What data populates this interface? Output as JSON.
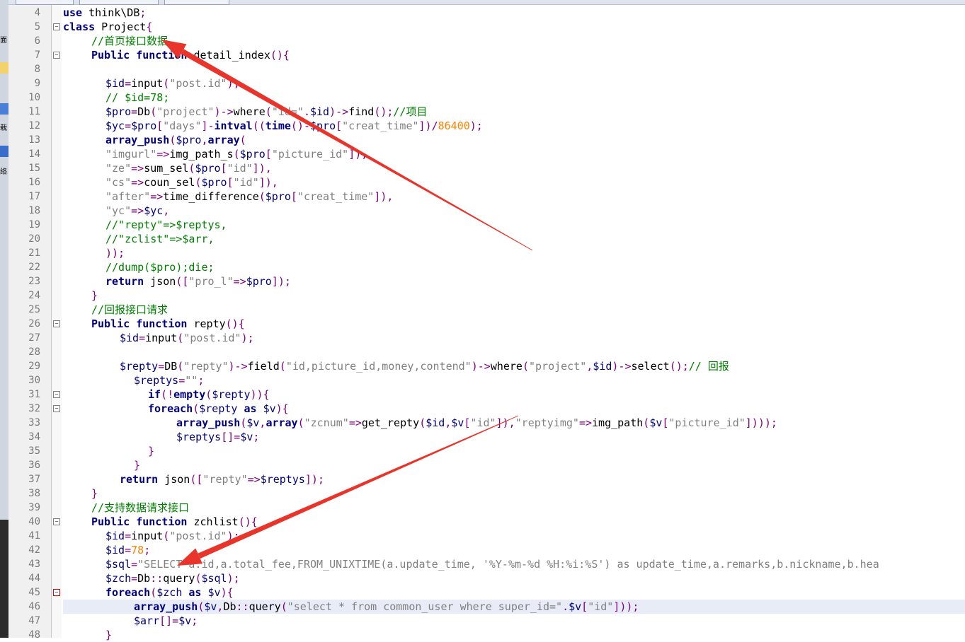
{
  "sidebar": {
    "icons": [
      "面",
      "",
      "",
      "",
      "栽",
      "",
      "络"
    ]
  },
  "editor": {
    "lines": [
      {
        "n": "4",
        "indent": 0,
        "tokens": [
          [
            "kw",
            "use"
          ],
          [
            "fn",
            " think\\DB"
          ],
          [
            "op",
            ";"
          ]
        ]
      },
      {
        "n": "5",
        "indent": 0,
        "tokens": [
          [
            "kw",
            "class"
          ],
          [
            "fn",
            " Project"
          ],
          [
            "op",
            "{"
          ]
        ]
      },
      {
        "n": "6",
        "indent": 2,
        "tokens": [
          [
            "cm",
            "//首页接口数据"
          ]
        ]
      },
      {
        "n": "7",
        "indent": 2,
        "tokens": [
          [
            "kw",
            "Public function"
          ],
          [
            "fn",
            " detail_index"
          ],
          [
            "op",
            "(){"
          ]
        ]
      },
      {
        "n": "8",
        "indent": 0,
        "tokens": []
      },
      {
        "n": "9",
        "indent": 3,
        "tokens": [
          [
            "var",
            "$id"
          ],
          [
            "op",
            "="
          ],
          [
            "fn",
            "input"
          ],
          [
            "op",
            "("
          ],
          [
            "str",
            "\"post.id\""
          ],
          [
            "op",
            ");"
          ]
        ]
      },
      {
        "n": "10",
        "indent": 3,
        "tokens": [
          [
            "cm",
            "// $id=78;"
          ]
        ]
      },
      {
        "n": "11",
        "indent": 3,
        "tokens": [
          [
            "var",
            "$pro"
          ],
          [
            "op",
            "="
          ],
          [
            "fn",
            "Db"
          ],
          [
            "op",
            "("
          ],
          [
            "str",
            "\"project\""
          ],
          [
            "op",
            ")->"
          ],
          [
            "fn",
            "where"
          ],
          [
            "op",
            "("
          ],
          [
            "str",
            "\"id=\""
          ],
          [
            "op",
            "."
          ],
          [
            "var",
            "$id"
          ],
          [
            "op",
            ")->"
          ],
          [
            "fn",
            "find"
          ],
          [
            "op",
            "();"
          ],
          [
            "cm",
            "//项目"
          ]
        ]
      },
      {
        "n": "12",
        "indent": 3,
        "tokens": [
          [
            "var",
            "$yc"
          ],
          [
            "op",
            "="
          ],
          [
            "var",
            "$pro"
          ],
          [
            "op",
            "["
          ],
          [
            "str",
            "\"days\""
          ],
          [
            "op",
            "]-"
          ],
          [
            "kw",
            "intval"
          ],
          [
            "op",
            "(("
          ],
          [
            "kw",
            "time"
          ],
          [
            "op",
            "()-"
          ],
          [
            "var",
            "$pro"
          ],
          [
            "op",
            "["
          ],
          [
            "str",
            "\"creat_time\""
          ],
          [
            "op",
            "])/"
          ],
          [
            "num",
            "86400"
          ],
          [
            "op",
            ");"
          ]
        ]
      },
      {
        "n": "13",
        "indent": 3,
        "tokens": [
          [
            "kw",
            "array_push"
          ],
          [
            "op",
            "("
          ],
          [
            "var",
            "$pro"
          ],
          [
            "op",
            ","
          ],
          [
            "kw",
            "array"
          ],
          [
            "op",
            "("
          ]
        ]
      },
      {
        "n": "14",
        "indent": 3,
        "tokens": [
          [
            "str",
            "\"imgurl\""
          ],
          [
            "op",
            "=>"
          ],
          [
            "fn",
            "img_path_s"
          ],
          [
            "op",
            "("
          ],
          [
            "var",
            "$pro"
          ],
          [
            "op",
            "["
          ],
          [
            "str",
            "\"picture_id\""
          ],
          [
            "op",
            "]),"
          ]
        ]
      },
      {
        "n": "15",
        "indent": 3,
        "tokens": [
          [
            "str",
            "\"ze\""
          ],
          [
            "op",
            "=>"
          ],
          [
            "fn",
            "sum_sel"
          ],
          [
            "op",
            "("
          ],
          [
            "var",
            "$pro"
          ],
          [
            "op",
            "["
          ],
          [
            "str",
            "\"id\""
          ],
          [
            "op",
            "]),"
          ]
        ]
      },
      {
        "n": "16",
        "indent": 3,
        "tokens": [
          [
            "str",
            "\"cs\""
          ],
          [
            "op",
            "=>"
          ],
          [
            "fn",
            "coun_sel"
          ],
          [
            "op",
            "("
          ],
          [
            "var",
            "$pro"
          ],
          [
            "op",
            "["
          ],
          [
            "str",
            "\"id\""
          ],
          [
            "op",
            "]),"
          ]
        ]
      },
      {
        "n": "17",
        "indent": 3,
        "tokens": [
          [
            "str",
            "\"after\""
          ],
          [
            "op",
            "=>"
          ],
          [
            "fn",
            "time_difference"
          ],
          [
            "op",
            "("
          ],
          [
            "var",
            "$pro"
          ],
          [
            "op",
            "["
          ],
          [
            "str",
            "\"creat_time\""
          ],
          [
            "op",
            "]),"
          ]
        ]
      },
      {
        "n": "18",
        "indent": 3,
        "tokens": [
          [
            "str",
            "\"yc\""
          ],
          [
            "op",
            "=>"
          ],
          [
            "var",
            "$yc"
          ],
          [
            "op",
            ","
          ]
        ]
      },
      {
        "n": "19",
        "indent": 3,
        "tokens": [
          [
            "cm",
            "//\"repty\"=>$reptys,"
          ]
        ]
      },
      {
        "n": "20",
        "indent": 3,
        "tokens": [
          [
            "cm",
            "//\"zclist\"=>$arr,"
          ]
        ]
      },
      {
        "n": "21",
        "indent": 3,
        "tokens": [
          [
            "op",
            "));"
          ]
        ]
      },
      {
        "n": "22",
        "indent": 3,
        "tokens": [
          [
            "cm",
            "//dump($pro);die;"
          ]
        ]
      },
      {
        "n": "23",
        "indent": 3,
        "tokens": [
          [
            "kw",
            "return"
          ],
          [
            "fn",
            " json"
          ],
          [
            "op",
            "(["
          ],
          [
            "str",
            "\"pro_l\""
          ],
          [
            "op",
            "=>"
          ],
          [
            "var",
            "$pro"
          ],
          [
            "op",
            "]);"
          ]
        ]
      },
      {
        "n": "24",
        "indent": 2,
        "tokens": [
          [
            "op",
            "}"
          ]
        ]
      },
      {
        "n": "25",
        "indent": 2,
        "tokens": [
          [
            "cm",
            "//回报接口请求"
          ]
        ]
      },
      {
        "n": "26",
        "indent": 2,
        "tokens": [
          [
            "kw",
            "Public function"
          ],
          [
            "fn",
            " repty"
          ],
          [
            "op",
            "(){"
          ]
        ]
      },
      {
        "n": "27",
        "indent": 4,
        "tokens": [
          [
            "var",
            "$id"
          ],
          [
            "op",
            "="
          ],
          [
            "fn",
            "input"
          ],
          [
            "op",
            "("
          ],
          [
            "str",
            "\"post.id\""
          ],
          [
            "op",
            ");"
          ]
        ]
      },
      {
        "n": "28",
        "indent": 0,
        "tokens": []
      },
      {
        "n": "29",
        "indent": 4,
        "tokens": [
          [
            "var",
            "$repty"
          ],
          [
            "op",
            "="
          ],
          [
            "fn",
            "DB"
          ],
          [
            "op",
            "("
          ],
          [
            "str",
            "\"repty\""
          ],
          [
            "op",
            ")->"
          ],
          [
            "fn",
            "field"
          ],
          [
            "op",
            "("
          ],
          [
            "str",
            "\"id,picture_id,money,contend\""
          ],
          [
            "op",
            ")->"
          ],
          [
            "fn",
            "where"
          ],
          [
            "op",
            "("
          ],
          [
            "str",
            "\"project\""
          ],
          [
            "op",
            ","
          ],
          [
            "var",
            "$id"
          ],
          [
            "op",
            ")->"
          ],
          [
            "fn",
            "select"
          ],
          [
            "op",
            "();"
          ],
          [
            "cm",
            "// 回报"
          ]
        ]
      },
      {
        "n": "30",
        "indent": 5,
        "tokens": [
          [
            "var",
            "$reptys"
          ],
          [
            "op",
            "="
          ],
          [
            "str",
            "\"\""
          ],
          [
            "op",
            ";"
          ]
        ]
      },
      {
        "n": "31",
        "indent": 6,
        "tokens": [
          [
            "kw",
            "if"
          ],
          [
            "op",
            "(!"
          ],
          [
            "kw",
            "empty"
          ],
          [
            "op",
            "("
          ],
          [
            "var",
            "$repty"
          ],
          [
            "op",
            "))"
          ],
          [
            "op",
            "{"
          ]
        ]
      },
      {
        "n": "32",
        "indent": 6,
        "tokens": [
          [
            "kw",
            "foreach"
          ],
          [
            "op",
            "("
          ],
          [
            "var",
            "$repty"
          ],
          [
            "kw",
            " as "
          ],
          [
            "var",
            "$v"
          ],
          [
            "op",
            "){"
          ]
        ]
      },
      {
        "n": "33",
        "indent": 8,
        "tokens": [
          [
            "kw",
            "array_push"
          ],
          [
            "op",
            "("
          ],
          [
            "var",
            "$v"
          ],
          [
            "op",
            ","
          ],
          [
            "kw",
            "array"
          ],
          [
            "op",
            "("
          ],
          [
            "str",
            "\"zcnum\""
          ],
          [
            "op",
            "=>"
          ],
          [
            "fn",
            "get_repty"
          ],
          [
            "op",
            "("
          ],
          [
            "var",
            "$id"
          ],
          [
            "op",
            ","
          ],
          [
            "var",
            "$v"
          ],
          [
            "op",
            "["
          ],
          [
            "str",
            "\"id\""
          ],
          [
            "op",
            "]),"
          ],
          [
            "str",
            "\"reptyimg\""
          ],
          [
            "op",
            "=>"
          ],
          [
            "fn",
            "img_path"
          ],
          [
            "op",
            "("
          ],
          [
            "var",
            "$v"
          ],
          [
            "op",
            "["
          ],
          [
            "str",
            "\"picture_id\""
          ],
          [
            "op",
            "])));"
          ]
        ]
      },
      {
        "n": "34",
        "indent": 8,
        "tokens": [
          [
            "var",
            "$reptys"
          ],
          [
            "op",
            "[]="
          ],
          [
            "var",
            "$v"
          ],
          [
            "op",
            ";"
          ]
        ]
      },
      {
        "n": "35",
        "indent": 6,
        "tokens": [
          [
            "op",
            "}"
          ]
        ]
      },
      {
        "n": "36",
        "indent": 5,
        "tokens": [
          [
            "op",
            "}"
          ]
        ]
      },
      {
        "n": "37",
        "indent": 4,
        "tokens": [
          [
            "kw",
            "return"
          ],
          [
            "fn",
            " json"
          ],
          [
            "op",
            "(["
          ],
          [
            "str",
            "\"repty\""
          ],
          [
            "op",
            "=>"
          ],
          [
            "var",
            "$reptys"
          ],
          [
            "op",
            "]);"
          ]
        ]
      },
      {
        "n": "38",
        "indent": 2,
        "tokens": [
          [
            "op",
            "}"
          ]
        ]
      },
      {
        "n": "39",
        "indent": 2,
        "tokens": [
          [
            "cm",
            "//支持数据请求接口"
          ]
        ]
      },
      {
        "n": "40",
        "indent": 2,
        "tokens": [
          [
            "kw",
            "Public function"
          ],
          [
            "fn",
            " zchlist"
          ],
          [
            "op",
            "(){"
          ]
        ]
      },
      {
        "n": "41",
        "indent": 3,
        "tokens": [
          [
            "var",
            "$id"
          ],
          [
            "op",
            "="
          ],
          [
            "fn",
            "input"
          ],
          [
            "op",
            "("
          ],
          [
            "str",
            "\"post.id\""
          ],
          [
            "op",
            ");"
          ]
        ]
      },
      {
        "n": "42",
        "indent": 3,
        "tokens": [
          [
            "var",
            "$id"
          ],
          [
            "op",
            "="
          ],
          [
            "num",
            "78"
          ],
          [
            "op",
            ";"
          ]
        ]
      },
      {
        "n": "43",
        "indent": 3,
        "tokens": [
          [
            "var",
            "$sql"
          ],
          [
            "op",
            "="
          ],
          [
            "str",
            "\"SELECT a.id,a.total_fee,FROM_UNIXTIME(a.update_time, '%Y-%m-%d %H:%i:%S') as update_time,a.remarks,b.nickname,b.hea"
          ]
        ]
      },
      {
        "n": "44",
        "indent": 3,
        "tokens": [
          [
            "var",
            "$zch"
          ],
          [
            "op",
            "="
          ],
          [
            "fn",
            "Db"
          ],
          [
            "op",
            "::"
          ],
          [
            "fn",
            "query"
          ],
          [
            "op",
            "("
          ],
          [
            "var",
            "$sql"
          ],
          [
            "op",
            ");"
          ]
        ]
      },
      {
        "n": "45",
        "indent": 3,
        "tokens": [
          [
            "kw",
            "foreach"
          ],
          [
            "op",
            "("
          ],
          [
            "var",
            "$zch"
          ],
          [
            "kw",
            " as "
          ],
          [
            "var",
            "$v"
          ],
          [
            "op",
            "){"
          ]
        ]
      },
      {
        "n": "46",
        "indent": 5,
        "tokens": [
          [
            "kw",
            "array_push"
          ],
          [
            "op",
            "("
          ],
          [
            "var",
            "$v"
          ],
          [
            "op",
            ","
          ],
          [
            "fn",
            "Db"
          ],
          [
            "op",
            "::"
          ],
          [
            "fn",
            "query"
          ],
          [
            "op",
            "("
          ],
          [
            "str",
            "\"select * from common_user where super_id=\""
          ],
          [
            "op",
            "."
          ],
          [
            "var",
            "$v"
          ],
          [
            "op",
            "["
          ],
          [
            "str",
            "\"id\""
          ],
          [
            "op",
            "]));"
          ]
        ]
      },
      {
        "n": "47",
        "indent": 5,
        "tokens": [
          [
            "var",
            "$arr"
          ],
          [
            "op",
            "[]="
          ],
          [
            "var",
            "$v"
          ],
          [
            "op",
            ";"
          ]
        ]
      },
      {
        "n": "48",
        "indent": 3,
        "tokens": [
          [
            "op",
            "}"
          ]
        ]
      }
    ],
    "highlight_line": "46",
    "fold_markers": {
      "5": "-",
      "7": "-",
      "26": "-",
      "31": "-",
      "32": "-",
      "40": "-",
      "45": "-r"
    }
  },
  "colors": {
    "arrow": "#e8342a"
  }
}
